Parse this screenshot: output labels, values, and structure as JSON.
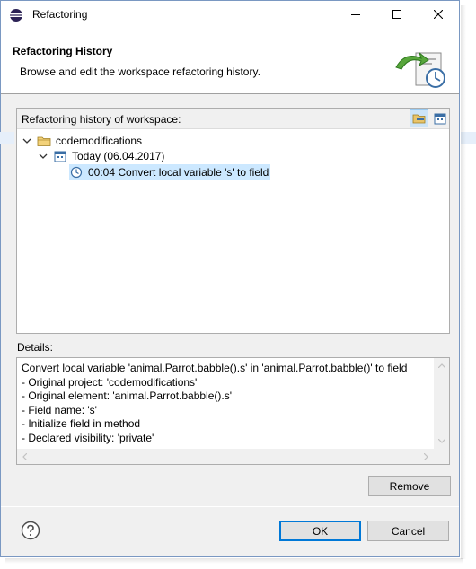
{
  "window": {
    "title": "Refactoring"
  },
  "banner": {
    "title": "Refactoring History",
    "description": "Browse and edit the workspace refactoring history."
  },
  "history": {
    "group_label": "Refactoring history of workspace:",
    "tree": {
      "project": "codemodifications",
      "date_node": "Today (06.04.2017)",
      "entry": "00:04 Convert local variable 's' to field"
    }
  },
  "details": {
    "label": "Details:",
    "lines": [
      "Convert local variable 'animal.Parrot.babble().s' in 'animal.Parrot.babble()' to field",
      "- Original project: 'codemodifications'",
      "- Original element: 'animal.Parrot.babble().s'",
      "- Field name: 's'",
      "- Initialize field in method",
      "- Declared visibility: 'private'"
    ]
  },
  "buttons": {
    "remove": "Remove",
    "ok": "OK",
    "cancel": "Cancel"
  },
  "icons": {
    "app": "eclipse-icon",
    "minimize": "minimize-icon",
    "maximize": "maximize-icon",
    "close": "close-icon",
    "banner": "refactoring-history-wizard-icon",
    "group_by_project": "folder-group-icon",
    "group_by_date": "date-group-icon",
    "project": "folder-icon",
    "date": "calendar-icon",
    "entry": "clock-icon",
    "help": "help-icon"
  },
  "colors": {
    "accent": "#0078d7",
    "selection": "#cce8ff"
  }
}
